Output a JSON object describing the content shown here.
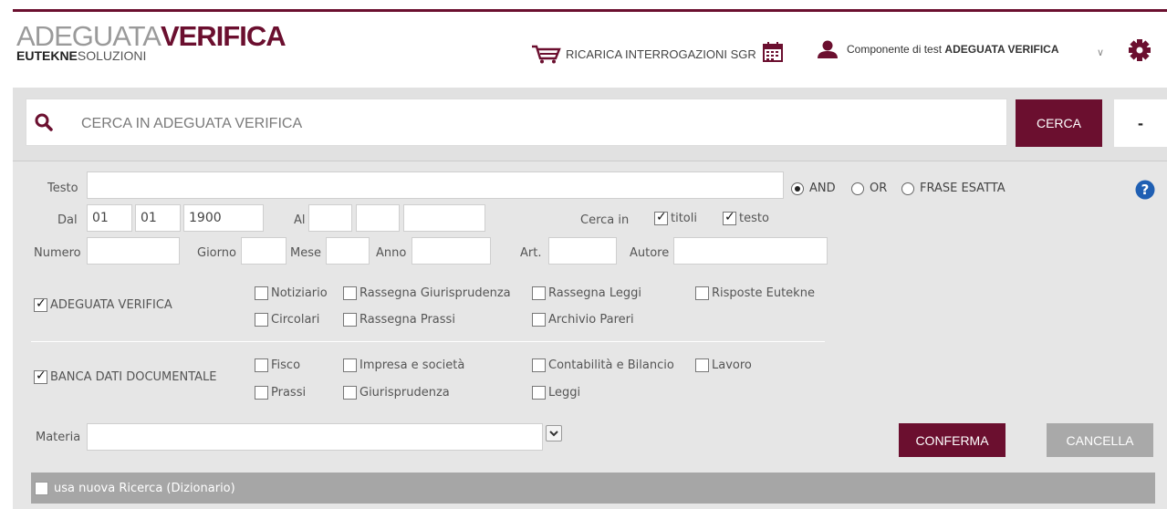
{
  "header": {
    "logo_top_a": "ADEGUATA",
    "logo_top_b": "VERIFICA",
    "logo_bottom_a": "EUTEKNE",
    "logo_bottom_b": "SOLUZIONI",
    "recharge_label": "RICARICA INTERROGAZIONI SGR",
    "user_prefix": "Componente di test",
    "user_name": "ADEGUATA VERIFICA",
    "caret": "∨"
  },
  "search": {
    "placeholder": "CERCA IN ADEGUATA VERIFICA",
    "button_label": "CERCA",
    "collapse_label": "-"
  },
  "form": {
    "testo_label": "Testo",
    "mode_options": [
      "AND",
      "OR",
      "FRASE ESATTA"
    ],
    "mode_selected": "AND",
    "dal_label": "Dal",
    "dal_day": "01",
    "dal_month": "01",
    "dal_year": "1900",
    "al_label": "Al",
    "cerca_in_label": "Cerca in",
    "cerca_in_titoli": "titoli",
    "cerca_in_testo": "testo",
    "numero_label": "Numero",
    "giorno_label": "Giorno",
    "mese_label": "Mese",
    "anno_label": "Anno",
    "art_label": "Art.",
    "autore_label": "Autore",
    "group1": {
      "label": "ADEGUATA VERIFICA",
      "checked": true,
      "options": [
        "Notiziario",
        "Rassegna Giurisprudenza",
        "Rassegna Leggi",
        "Risposte Eutekne",
        "Circolari",
        "Rassegna Prassi",
        "Archivio Pareri"
      ]
    },
    "group2": {
      "label": "BANCA DATI DOCUMENTALE",
      "checked": true,
      "options": [
        "Fisco",
        "Impresa e società",
        "Contabilità e Bilancio",
        "Lavoro",
        "Prassi",
        "Giurisprudenza",
        "Leggi"
      ]
    },
    "materia_label": "Materia",
    "confirm_label": "CONFERMA",
    "cancel_label": "CANCELLA",
    "new_search_label": "usa nuova Ricerca (Dizionario)"
  },
  "colors": {
    "brand": "#6b0f2f",
    "panel": "#e6e6e6",
    "bar": "#a6a6a6"
  }
}
